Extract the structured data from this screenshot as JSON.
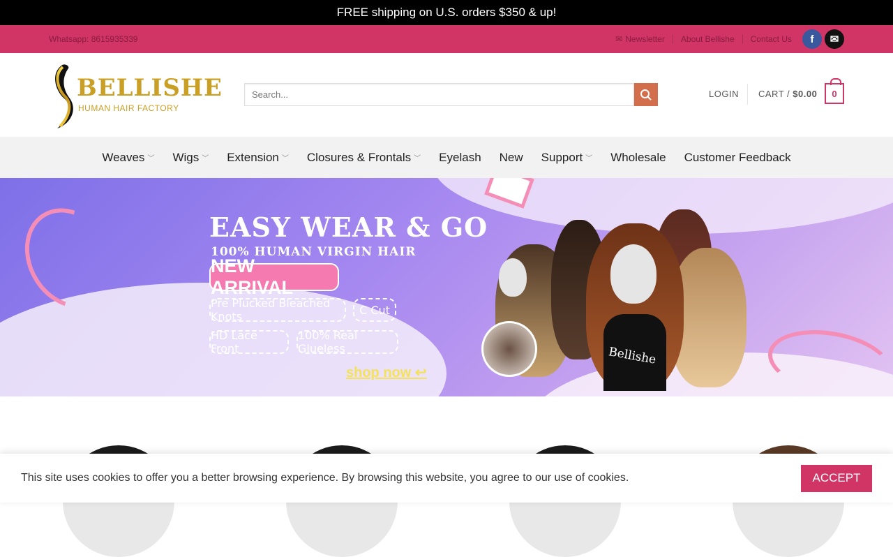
{
  "promo": {
    "text": "FREE shipping on U.S. orders $350 & up!"
  },
  "subbar": {
    "whatsapp": "Whatsapp: 8615935339",
    "newsletter": "Newsletter",
    "about": "About Bellishe",
    "contact": "Contact Us"
  },
  "header": {
    "logo_text": "BELLISHE",
    "logo_sub": "HUMAN HAIR FACTORY",
    "search_placeholder": "Search...",
    "login": "LOGIN",
    "cart_label": "CART /",
    "cart_total": "$0.00",
    "cart_count": "0"
  },
  "nav": {
    "items": [
      {
        "label": "Weaves",
        "dropdown": true
      },
      {
        "label": "Wigs",
        "dropdown": true
      },
      {
        "label": "Extension",
        "dropdown": true
      },
      {
        "label": "Closures & Frontals",
        "dropdown": true
      },
      {
        "label": "Eyelash",
        "dropdown": false
      },
      {
        "label": "New",
        "dropdown": false
      },
      {
        "label": "Support",
        "dropdown": true
      },
      {
        "label": "Wholesale",
        "dropdown": false
      },
      {
        "label": "Customer Feedback",
        "dropdown": false
      }
    ]
  },
  "banner": {
    "title": "EASY WEAR & GO",
    "subtitle": "100% HUMAN VIRGIN HAIR",
    "badge": "NEW ARRIVAL",
    "features": [
      "Pre Plucked Bleached Knots",
      "C Cut",
      "HD Lace Front",
      "100% Real Glueless"
    ],
    "cta": "shop now",
    "shirt_text": "Bellishe"
  },
  "cookie": {
    "message": "This site uses cookies to offer you a better browsing experience. By browsing this website, you agree to our use of cookies.",
    "accept": "ACCEPT"
  },
  "colors": {
    "brand": "#d03565",
    "search_button": "#d26e4b",
    "promo_bg": "#000000"
  }
}
